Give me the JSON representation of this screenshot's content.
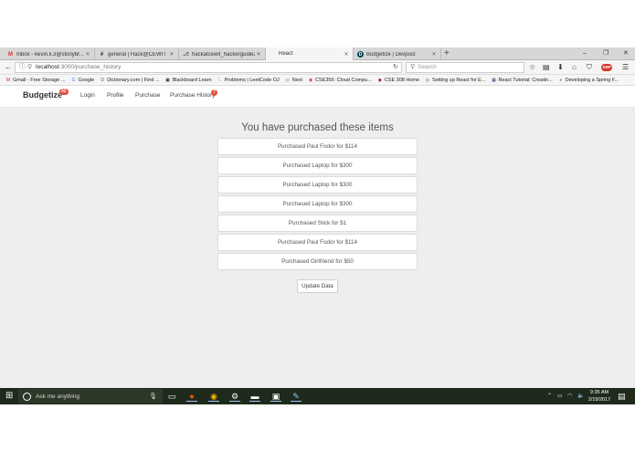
{
  "browser": {
    "tabs": [
      {
        "title": "Inbox - kevin.li.3@stonybr...",
        "favicon": "M",
        "favicon_color": "#d93025",
        "active": false
      },
      {
        "title": "general | Hack@CEWIT Sl...",
        "favicon": "#",
        "favicon_color": "#4a154b",
        "active": false
      },
      {
        "title": "hackatcewit_hackerguide2...",
        "favicon": "⎇",
        "favicon_color": "#555555",
        "active": false
      },
      {
        "title": "React",
        "favicon": "",
        "favicon_color": "#ffffff",
        "active": true
      },
      {
        "title": "Budgetize | Devpost",
        "favicon": "D",
        "favicon_color": "#003e54",
        "active": false
      }
    ],
    "new_tab_label": "+",
    "window_controls": {
      "minimize": "–",
      "maximize": "❐",
      "close": "✕"
    },
    "url": {
      "host": "localhost",
      "path": ":3000/purchase_history"
    },
    "search_placeholder": "Search",
    "bookmarks": [
      {
        "label": "Gmail - Free Storage ...",
        "icon": "M",
        "color": "#d93025"
      },
      {
        "label": "Google",
        "icon": "G",
        "color": "#4285f4"
      },
      {
        "label": "Dictionary.com | Find ...",
        "icon": "D",
        "color": "#1b6ac9"
      },
      {
        "label": "Blackboard Learn",
        "icon": "▣",
        "color": "#222222"
      },
      {
        "label": "Problems | LeetCode OJ",
        "icon": "L",
        "color": "#f0a020"
      },
      {
        "label": "Next",
        "icon": "◎",
        "color": "#888888"
      },
      {
        "label": "CSE356: Cloud Compu...",
        "icon": "◉",
        "color": "#c0392b"
      },
      {
        "label": "CSE 308 Home",
        "icon": "◆",
        "color": "#b0121b"
      },
      {
        "label": "Setting up React for E...",
        "icon": "◍",
        "color": "#888888"
      },
      {
        "label": "React Tutorial: Creatin...",
        "icon": "▦",
        "color": "#1a3a6e"
      },
      {
        "label": "Developing a Spring F...",
        "icon": "●",
        "color": "#6db33f"
      }
    ]
  },
  "app": {
    "brand": "Budgetize",
    "brand_badge": "92",
    "nav": [
      {
        "label": "Login"
      },
      {
        "label": "Profile"
      },
      {
        "label": "Purchase"
      },
      {
        "label": "Purchase History"
      }
    ],
    "nav_badge": "7",
    "page_title": "You have purchased these items",
    "items": [
      "Purchased Paul Fodor for $114",
      "Purchased Laptop for $300",
      "Purchased Laptop for $300",
      "Purchased Laptop for $300",
      "Purchased Stick for $1",
      "Purchased Paul Fodor for $114",
      "Purchased Girlfriend for $50"
    ],
    "update_button": "Update Data"
  },
  "taskbar": {
    "search_placeholder": "Ask me anything",
    "time": "9:35 AM",
    "date": "2/19/2017"
  }
}
